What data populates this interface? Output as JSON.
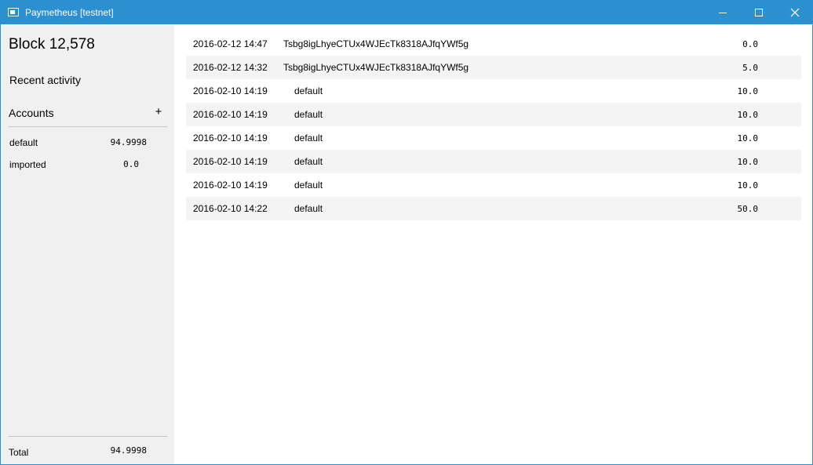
{
  "window": {
    "title": "Paymetheus [testnet]",
    "accent_color": "#2b8fd0",
    "controls": [
      "minimize-icon",
      "maximize-icon",
      "close-icon"
    ]
  },
  "sidebar": {
    "block_label": "Block 12,578",
    "recent_activity": "Recent activity",
    "accounts_title": "Accounts",
    "add_label": "+",
    "accounts": [
      {
        "name": "default",
        "balance": "94.9998"
      },
      {
        "name": "imported",
        "balance": "0.0"
      }
    ],
    "total_label": "Total",
    "total_value": "94.9998"
  },
  "transactions": [
    {
      "date": "2016-02-12 14:47",
      "account": "Tsbg8igLhyeCTUx4WJEcTk8318AJfqYWf5g",
      "amount": "0.0"
    },
    {
      "date": "2016-02-12 14:32",
      "account": "Tsbg8igLhyeCTUx4WJEcTk8318AJfqYWf5g",
      "amount": "5.0"
    },
    {
      "date": "2016-02-10 14:19",
      "account": "default",
      "amount": "10.0"
    },
    {
      "date": "2016-02-10 14:19",
      "account": "default",
      "amount": "10.0"
    },
    {
      "date": "2016-02-10 14:19",
      "account": "default",
      "amount": "10.0"
    },
    {
      "date": "2016-02-10 14:19",
      "account": "default",
      "amount": "10.0"
    },
    {
      "date": "2016-02-10 14:19",
      "account": "default",
      "amount": "10.0"
    },
    {
      "date": "2016-02-10 14:22",
      "account": "default",
      "amount": "50.0"
    }
  ]
}
